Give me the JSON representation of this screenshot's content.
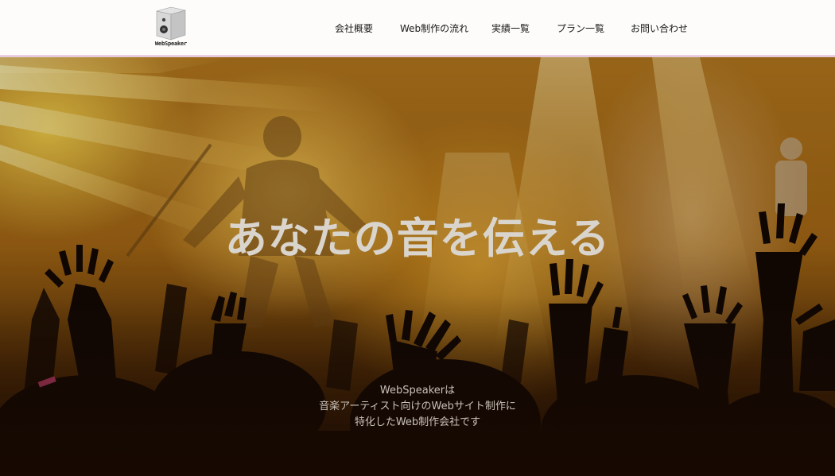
{
  "brand": {
    "logo_text": "WebSpeaker"
  },
  "nav": {
    "items": [
      {
        "label": "会社概要"
      },
      {
        "label": "Web制作の流れ"
      },
      {
        "label": "実績一覧"
      },
      {
        "label": "プラン一覧"
      },
      {
        "label": "お問い合わせ"
      }
    ]
  },
  "hero": {
    "title": "あなたの音を伝える",
    "description_lines": [
      "WebSpeakerは",
      "音楽アーティスト向けのWebサイト制作に",
      "特化したWeb制作会社です"
    ]
  },
  "colors": {
    "header_bg": "#fdfcfa",
    "header_border": "#c77ab6",
    "hero_orange": "#b87a1e",
    "hero_text": "#d9d4cc"
  }
}
